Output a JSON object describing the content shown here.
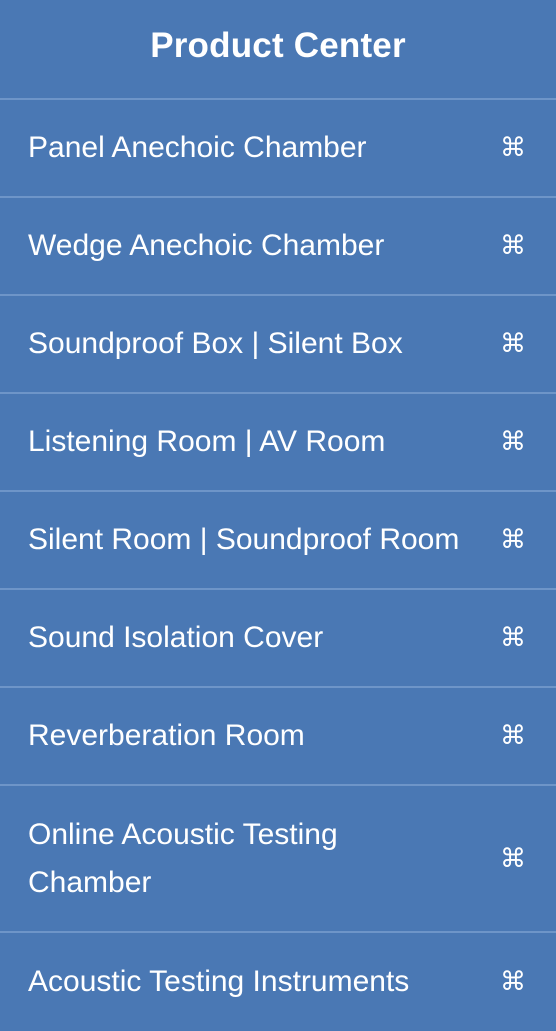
{
  "header": {
    "title": "Product Center"
  },
  "menu": {
    "items": [
      {
        "label": "Panel Anechoic Chamber",
        "icon": "command-icon",
        "glyph": "⌘"
      },
      {
        "label": "Wedge Anechoic Chamber",
        "icon": "command-icon",
        "glyph": "⌘"
      },
      {
        "label": "Soundproof Box | Silent Box",
        "icon": "command-icon",
        "glyph": "⌘"
      },
      {
        "label": "Listening Room | AV Room",
        "icon": "command-icon",
        "glyph": "⌘"
      },
      {
        "label": "Silent Room | Soundproof Room",
        "icon": "command-icon",
        "glyph": "⌘"
      },
      {
        "label": "Sound Isolation Cover",
        "icon": "command-icon",
        "glyph": "⌘"
      },
      {
        "label": "Reverberation Room",
        "icon": "command-icon",
        "glyph": "⌘"
      },
      {
        "label": "Online Acoustic Testing Chamber",
        "icon": "command-icon",
        "glyph": "⌘"
      },
      {
        "label": "Acoustic Testing Instruments",
        "icon": "command-icon",
        "glyph": "⌘"
      }
    ]
  },
  "colors": {
    "background": "#4a78b4",
    "divider": "#6e95c8",
    "text": "#ffffff"
  }
}
